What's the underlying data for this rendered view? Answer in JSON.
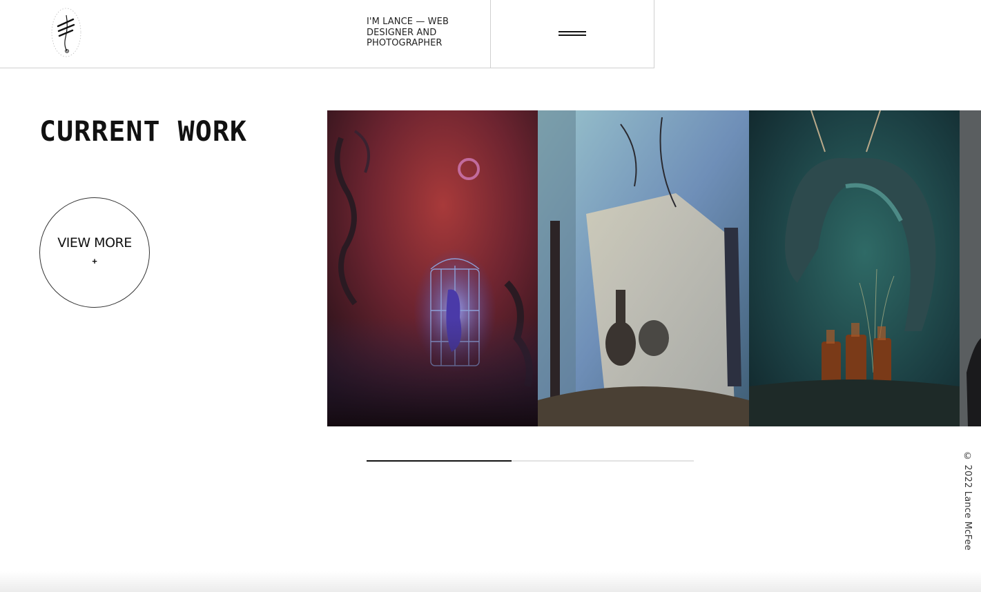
{
  "header": {
    "logo_name": "signature-logo",
    "tagline": "I'M LANCE — WEB DESIGNER AND PHOTOGRAPHER",
    "menu_icon": "hamburger-icon"
  },
  "main": {
    "section_title": "CURRENT WORK",
    "view_more_label": "VIEW MORE",
    "view_more_icon": "+"
  },
  "gallery": {
    "photos": [
      {
        "subject": "birdcage-with-blue-hand-red-light",
        "accent": "#8a2a2a"
      },
      {
        "subject": "paper-and-vase-blue-still-life",
        "accent": "#7fa3b3"
      },
      {
        "subject": "driftwood-with-amber-bottles",
        "accent": "#1f5a55"
      },
      {
        "subject": "dark-still-life-partial",
        "accent": "#3a3a3a"
      }
    ],
    "progress_fraction": 0.444
  },
  "footer": {
    "copyright": "© 2022 Lance McFee"
  }
}
